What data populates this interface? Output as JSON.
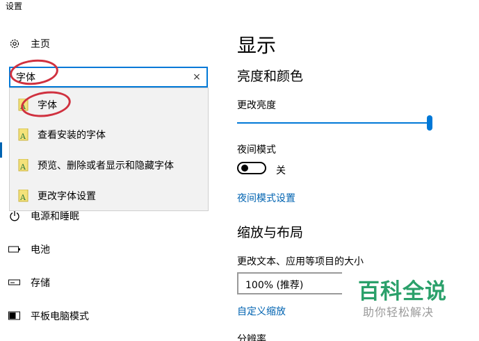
{
  "window": {
    "title": "设置"
  },
  "sidebar": {
    "home": {
      "label": "主页",
      "icon": "gear-icon"
    },
    "items": [
      {
        "label": "电源和睡眠",
        "icon": "power-icon"
      },
      {
        "label": "电池",
        "icon": "battery-icon"
      },
      {
        "label": "存储",
        "icon": "storage-icon"
      },
      {
        "label": "平板电脑模式",
        "icon": "tablet-icon"
      }
    ]
  },
  "search": {
    "value": "字体",
    "clear_icon": "×",
    "suggestions": [
      {
        "label": "字体",
        "icon": "font-settings-icon"
      },
      {
        "label": "查看安装的字体",
        "icon": "font-settings-icon"
      },
      {
        "label": "预览、删除或者显示和隐藏字体",
        "icon": "font-settings-icon"
      },
      {
        "label": "更改字体设置",
        "icon": "font-settings-icon"
      }
    ]
  },
  "main": {
    "title": "显示",
    "brightness_section": "亮度和颜色",
    "brightness_label": "更改亮度",
    "brightness_level": 1.0,
    "night_mode_label": "夜间模式",
    "night_mode_state": "关",
    "night_mode_link": "夜间模式设置",
    "scale_section": "缩放与布局",
    "scale_label": "更改文本、应用等项目的大小",
    "scale_value": "100% (推荐)",
    "custom_scale_link": "自定义缩放",
    "resolution_label": "分辨率"
  },
  "watermark": {
    "main": "百科全说",
    "sub": "助你轻松解决"
  },
  "colors": {
    "accent": "#0078d7",
    "link": "#0063b1",
    "annotation": "#d0313f",
    "watermark_green": "#2aa06a"
  }
}
